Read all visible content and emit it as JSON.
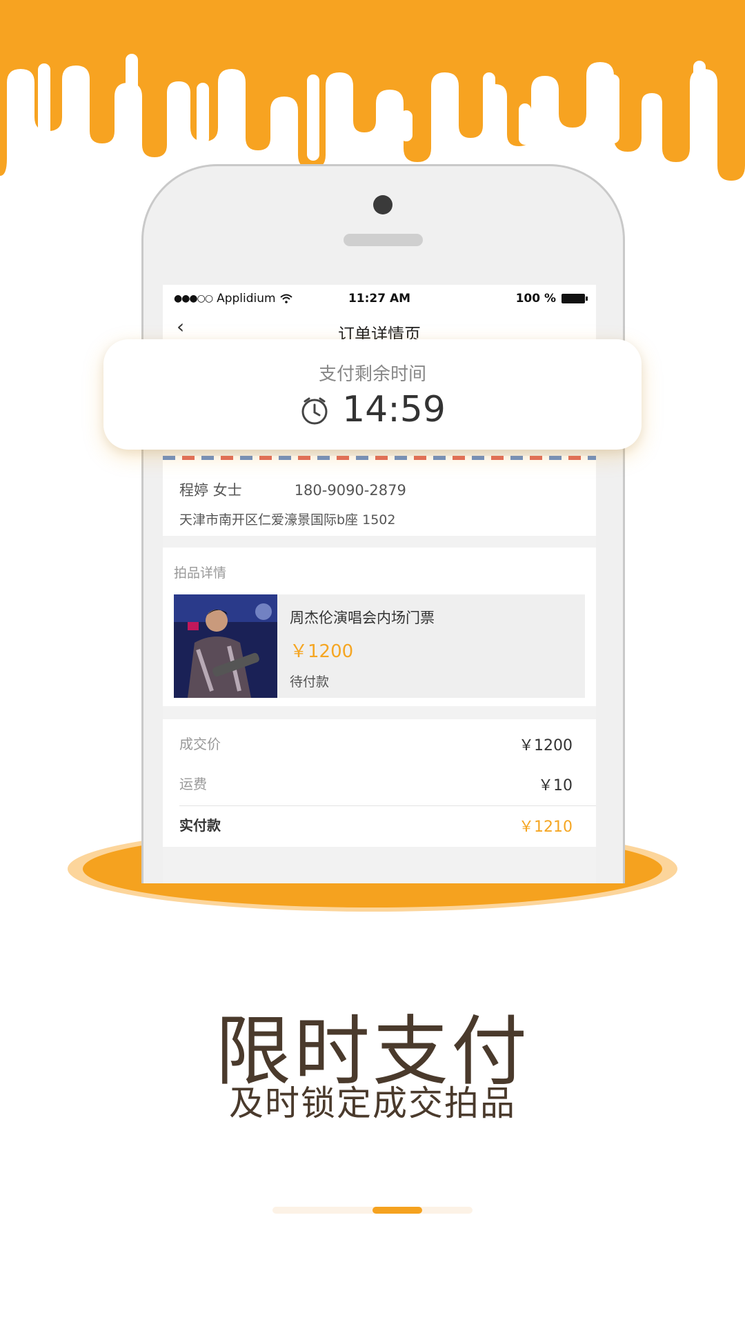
{
  "status_bar": {
    "carrier": "Applidium",
    "time": "11:27 AM",
    "battery": "100 %"
  },
  "nav": {
    "title": "订单详情页"
  },
  "timer": {
    "label": "支付剩余时间",
    "value": "14:59"
  },
  "address": {
    "name": "程婷  女士",
    "phone": "180-9090-2879",
    "detail": "天津市南开区仁爱濠景国际b座   1502"
  },
  "item": {
    "section_title": "拍品详情",
    "name": "周杰伦演唱会内场门票",
    "price": "￥1200",
    "status": "待付款"
  },
  "pricing": {
    "deal_label": "成交价",
    "deal_value": "￥1200",
    "shipping_label": "运费",
    "shipping_value": "￥10",
    "total_label": "实付款",
    "total_value": "￥1210"
  },
  "caption": {
    "headline": "限时支付",
    "subline": "及时锁定成交拍品"
  },
  "pager": {
    "pages": 3,
    "active": 2
  },
  "colors": {
    "accent": "#F5A21F",
    "drip": "#F7A321",
    "price": "#F5A623",
    "caption": "#4A3A2C"
  }
}
